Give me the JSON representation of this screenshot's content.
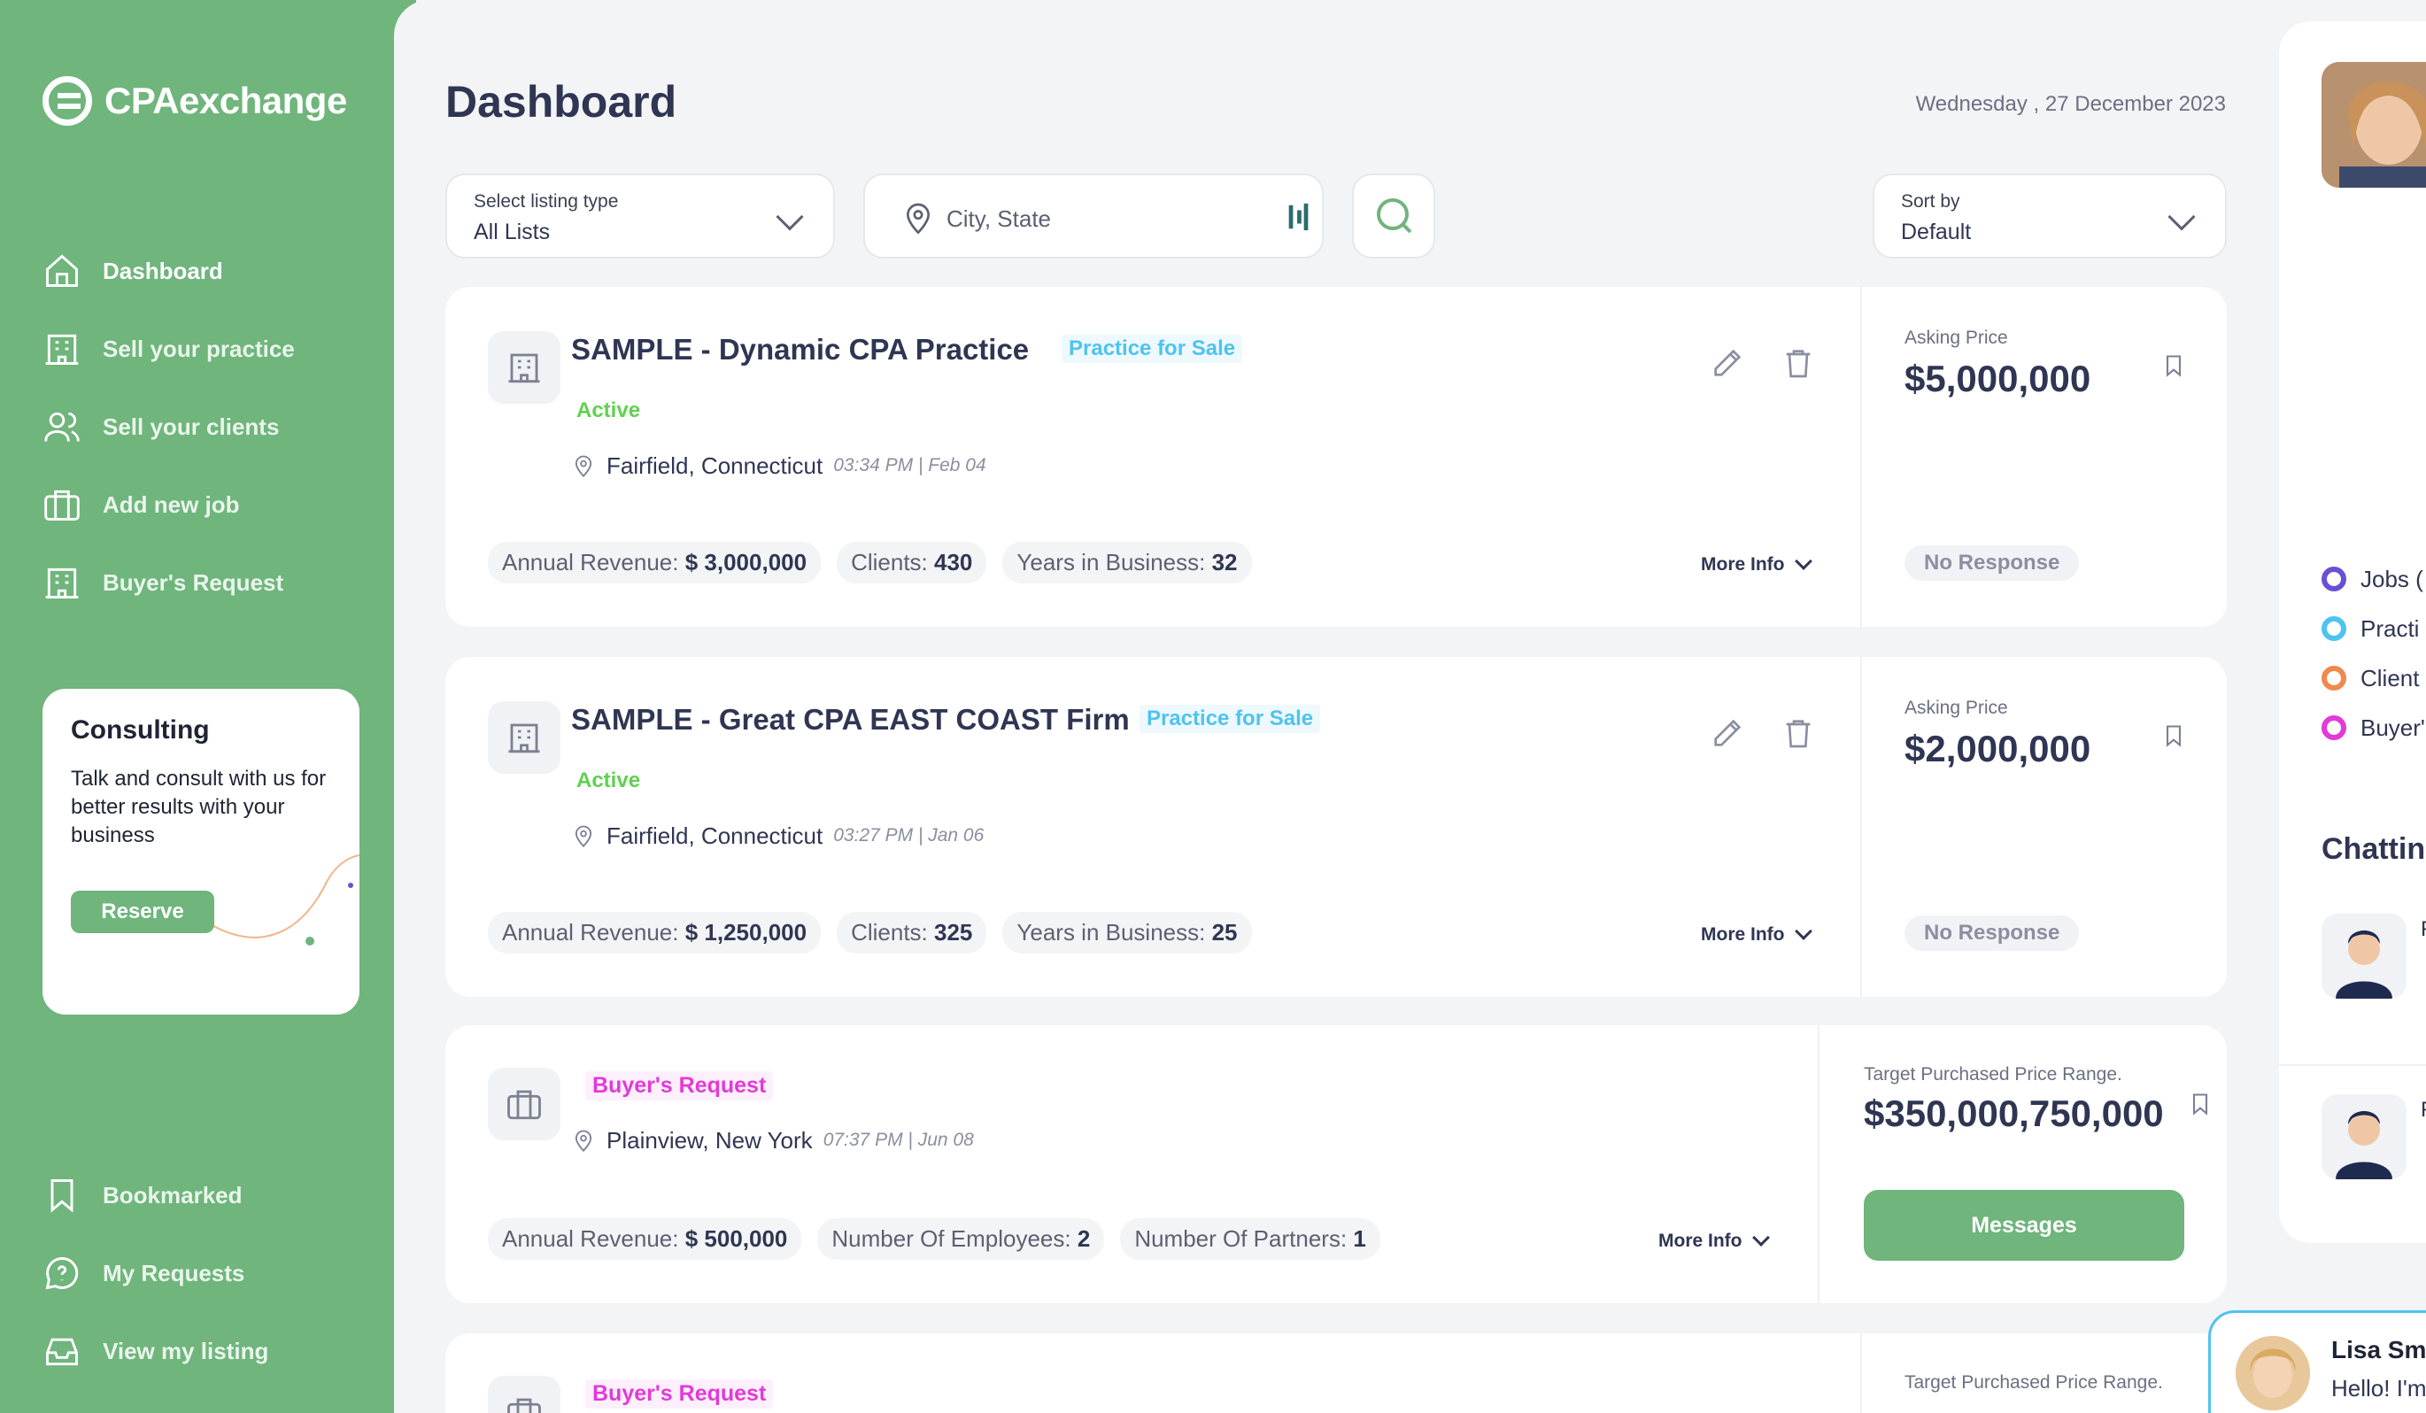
{
  "app": {
    "logo_text": "CPAexchange"
  },
  "sidebar": {
    "items": [
      {
        "label": "Dashboard",
        "icon": "home-icon"
      },
      {
        "label": "Sell your practice",
        "icon": "building-icon"
      },
      {
        "label": "Sell your clients",
        "icon": "users-icon"
      },
      {
        "label": "Add new job",
        "icon": "briefcase-icon"
      },
      {
        "label": "Buyer's Request",
        "icon": "building-icon"
      }
    ],
    "bottom_items": [
      {
        "label": "Bookmarked",
        "icon": "bookmark-icon"
      },
      {
        "label": "My Requests",
        "icon": "chat-question-icon"
      },
      {
        "label": "View my listing",
        "icon": "inbox-icon"
      }
    ],
    "consult": {
      "title": "Consulting",
      "text": "Talk and consult with us for better results with your business",
      "button": "Reserve"
    }
  },
  "header": {
    "title": "Dashboard",
    "date": "Wednesday , 27 December 2023"
  },
  "filters": {
    "listing_type_label": "Select listing type",
    "listing_type_value": "All Lists",
    "location_placeholder": "City, State",
    "sort_label": "Sort by",
    "sort_value": "Default"
  },
  "listings": [
    {
      "title": "SAMPLE - Dynamic CPA Practice",
      "type": "Practice for Sale",
      "status": "Active",
      "location": "Fairfield, Connecticut",
      "time": "03:34 PM | Feb 04",
      "stats": [
        {
          "label": "Annual Revenue:",
          "value": "$ 3,000,000"
        },
        {
          "label": "Clients:",
          "value": "430"
        },
        {
          "label": "Years in Business:",
          "value": "32"
        }
      ],
      "more": "More Info",
      "price_label": "Asking Price",
      "price": "$5,000,000",
      "response": "No Response"
    },
    {
      "title": "SAMPLE - Great CPA EAST COAST Firm",
      "type": "Practice for Sale",
      "status": "Active",
      "location": "Fairfield, Connecticut",
      "time": "03:27 PM | Jan 06",
      "stats": [
        {
          "label": "Annual Revenue:",
          "value": "$ 1,250,000"
        },
        {
          "label": "Clients:",
          "value": "325"
        },
        {
          "label": "Years in Business:",
          "value": "25"
        }
      ],
      "more": "More Info",
      "price_label": "Asking Price",
      "price": "$2,000,000",
      "response": "No Response"
    },
    {
      "type": "Buyer's Request",
      "location": "Plainview, New York",
      "time": "07:37 PM | Jun 08",
      "stats": [
        {
          "label": "Annual Revenue:",
          "value": "$ 500,000"
        },
        {
          "label": "Number Of Employees:",
          "value": "2"
        },
        {
          "label": "Number Of Partners:",
          "value": "1"
        }
      ],
      "more": "More Info",
      "price_label": "Target Purchased Price Range.",
      "price": "$350,000,750,000",
      "button": "Messages"
    },
    {
      "type": "Buyer's Request",
      "price_label": "Target Purchased Price Range."
    }
  ],
  "right_panel": {
    "legend": [
      {
        "label": "Jobs (",
        "color": "#6b4fd6"
      },
      {
        "label": "Practi",
        "color": "#4ec3f0"
      },
      {
        "label": "Client",
        "color": "#f0894e"
      },
      {
        "label": "Buyer'",
        "color": "#e23ad8"
      }
    ],
    "chat_title": "Chattin",
    "chat_initials": [
      "F",
      "F"
    ]
  },
  "chat_popup": {
    "name": "Lisa Smi",
    "message": "Hello! I'm"
  },
  "colors": {
    "brand": "#6fb57c",
    "sale": "#4ec3f0",
    "active": "#5fd14f",
    "buyer": "#e23ad8"
  }
}
